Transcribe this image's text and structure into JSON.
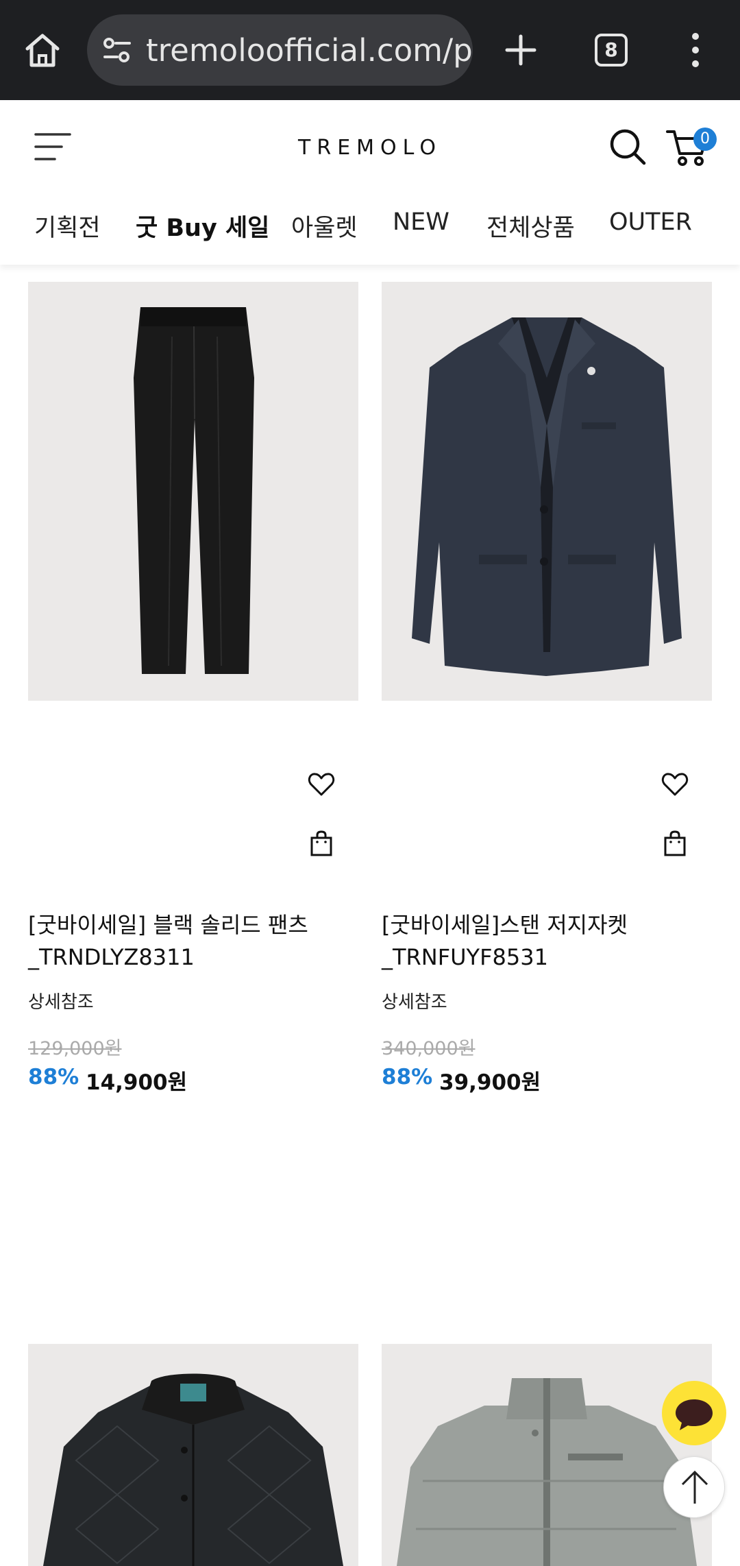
{
  "browser": {
    "url": "tremoloofficial.com/p",
    "tab_count": "8"
  },
  "header": {
    "logo": "TREMOLO",
    "cart_count": "0"
  },
  "nav_tabs": [
    {
      "label": "기획전"
    },
    {
      "label": "굿 Buy 세일"
    },
    {
      "label": "아울렛"
    },
    {
      "label": "NEW"
    },
    {
      "label": "전체상품"
    },
    {
      "label": "OUTER"
    }
  ],
  "products": [
    {
      "name_line1": "[굿바이세일] 블랙 솔리드 팬츠",
      "name_line2": "_TRNDLYZ8311",
      "desc": "상세참조",
      "original_price": "129,000원",
      "discount_rate": "88%",
      "sale_price": "14,900원",
      "image_icon": "black-pants"
    },
    {
      "name_line1": "[굿바이세일]스탠 저지자켓",
      "name_line2": "_TRNFUYF8531",
      "desc": "상세참조",
      "original_price": "340,000원",
      "discount_rate": "88%",
      "sale_price": "39,900원",
      "image_icon": "navy-blazer"
    },
    {
      "image_icon": "black-quilted-jacket"
    },
    {
      "image_icon": "grey-down-jacket"
    }
  ],
  "colors": {
    "accent_blue": "#1e7fd6",
    "chat_yellow": "#fde236",
    "browser_bar": "#1e1f22"
  }
}
